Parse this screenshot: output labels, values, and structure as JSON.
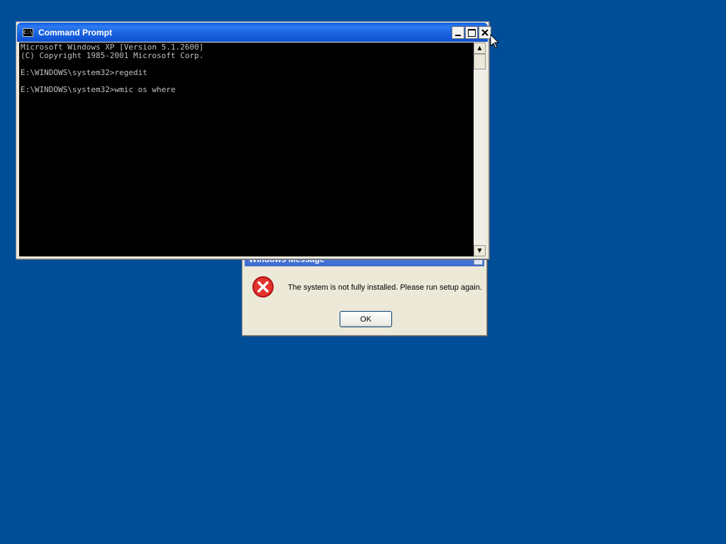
{
  "desktop": {
    "background": "#004e98"
  },
  "message_box": {
    "title": "Windows Message",
    "icon": "error-icon",
    "text": "The system is not fully installed.  Please run setup again.",
    "ok_label": "OK"
  },
  "cmd_window": {
    "title": "Command Prompt",
    "icon_label": "C:\\",
    "lines": [
      "Microsoft Windows XP [Version 5.1.2600]",
      "(C) Copyright 1985-2001 Microsoft Corp.",
      "",
      "E:\\WINDOWS\\system32>regedit",
      "",
      "E:\\WINDOWS\\system32>wmic os where"
    ]
  }
}
